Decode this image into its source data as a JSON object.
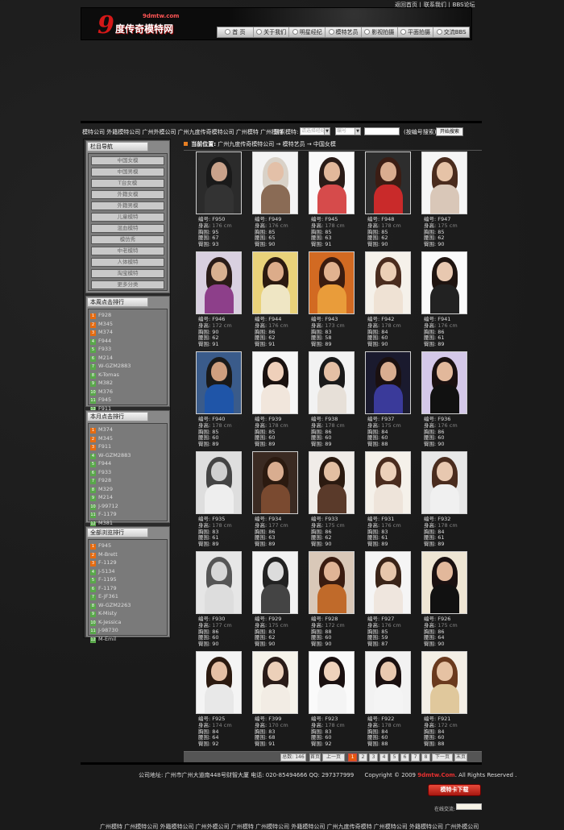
{
  "toplinks": [
    "返回首页",
    "|",
    "联系我们",
    "|",
    "BBS论坛"
  ],
  "header": {
    "logo_nine": "9",
    "logo_domain": "9dmtw.com",
    "logo_cn": "度传奇模特网",
    "nav": [
      "首 页",
      "关于我们",
      "明星经纪",
      "模特艺员",
      "影视拍摄",
      "平面拍摄",
      "交流BBS"
    ]
  },
  "search": {
    "keywords": "模特公司 外籍模特公司 广州外模公司 广州九度传奇模特公司 广州模特 广州模特",
    "label": "搜索模特:",
    "select1": "请选择经纪",
    "select2": "编号",
    "hint": "(按编号搜索)",
    "button": "开始搜索"
  },
  "sidebar": {
    "nav_title": "栏目导航",
    "nav_items": [
      "中国女模",
      "中国男模",
      "T台女模",
      "外籍女模",
      "外籍男模",
      "儿童模特",
      "混血模特",
      "模仿秀",
      "中老模特",
      "人体模特",
      "淘宝模特",
      "更多分类"
    ],
    "week_title": "本周点击排行",
    "week_items": [
      "F928",
      "M345",
      "M374",
      "F944",
      "F933",
      "M214",
      "W-GZM2883",
      "K-Tomas",
      "M382",
      "M376",
      "F945",
      "F911"
    ],
    "month_title": "本月点击排行",
    "month_items": [
      "M374",
      "M345",
      "F911",
      "W-GZM2883",
      "F944",
      "F933",
      "F928",
      "M329",
      "M214",
      "J-99712",
      "F-1179",
      "M381"
    ],
    "all_title": "全部浏览排行",
    "all_items": [
      "F945",
      "M-Brett",
      "F-1129",
      "J-5134",
      "F-1195",
      "F-1179",
      "E-JF361",
      "W-GZM2263",
      "K-Misty",
      "K-Jessica",
      "J-98730",
      "M-Emil"
    ]
  },
  "breadcrumb": {
    "label": "当前位置:",
    "path": "广州九度传奇模特公司 → 模特艺员 → 中国女模"
  },
  "field_labels": {
    "id": "编号:",
    "height": "身高:",
    "bust": "胸围:",
    "waist": "腰围:",
    "hip": "臀围:"
  },
  "models": [
    {
      "id": "F950",
      "height": "176 cm",
      "bust": "95",
      "waist": "67",
      "hip": "93"
    },
    {
      "id": "F949",
      "height": "176 cm",
      "bust": "85",
      "waist": "65",
      "hip": "90"
    },
    {
      "id": "F945",
      "height": "178 cm",
      "bust": "85",
      "waist": "63",
      "hip": "91"
    },
    {
      "id": "F948",
      "height": "178 cm",
      "bust": "85",
      "waist": "62",
      "hip": "90"
    },
    {
      "id": "F947",
      "height": "175 cm",
      "bust": "85",
      "waist": "62",
      "hip": "90"
    },
    {
      "id": "F946",
      "height": "172 cm",
      "bust": "90",
      "waist": "62",
      "hip": "91"
    },
    {
      "id": "F944",
      "height": "176 cm",
      "bust": "86",
      "waist": "62",
      "hip": "91"
    },
    {
      "id": "F943",
      "height": "173 cm",
      "bust": "83",
      "waist": "58",
      "hip": "89"
    },
    {
      "id": "F942",
      "height": "178 cm",
      "bust": "84",
      "waist": "60",
      "hip": "90"
    },
    {
      "id": "F941",
      "height": "176 cm",
      "bust": "86",
      "waist": "61",
      "hip": "89"
    },
    {
      "id": "F940",
      "height": "178 cm",
      "bust": "85",
      "waist": "60",
      "hip": "89"
    },
    {
      "id": "F939",
      "height": "178 cm",
      "bust": "85",
      "waist": "60",
      "hip": "89"
    },
    {
      "id": "F938",
      "height": "178 cm",
      "bust": "86",
      "waist": "60",
      "hip": "89"
    },
    {
      "id": "F937",
      "height": "175 cm",
      "bust": "84",
      "waist": "60",
      "hip": "88"
    },
    {
      "id": "F936",
      "height": "176 cm",
      "bust": "86",
      "waist": "60",
      "hip": "90"
    },
    {
      "id": "F935",
      "height": "178 cm",
      "bust": "83",
      "waist": "61",
      "hip": "89"
    },
    {
      "id": "F934",
      "height": "177 cm",
      "bust": "86",
      "waist": "63",
      "hip": "89"
    },
    {
      "id": "F933",
      "height": "175 cm",
      "bust": "86",
      "waist": "62",
      "hip": "90"
    },
    {
      "id": "F931",
      "height": "176 cm",
      "bust": "83",
      "waist": "61",
      "hip": "89"
    },
    {
      "id": "F932",
      "height": "178 cm",
      "bust": "84",
      "waist": "61",
      "hip": "89"
    },
    {
      "id": "F930",
      "height": "177 cm",
      "bust": "86",
      "waist": "60",
      "hip": "90"
    },
    {
      "id": "F929",
      "height": "175 cm",
      "bust": "83",
      "waist": "62",
      "hip": "90"
    },
    {
      "id": "F928",
      "height": "172 cm",
      "bust": "88",
      "waist": "60",
      "hip": "90"
    },
    {
      "id": "F927",
      "height": "176 cm",
      "bust": "85",
      "waist": "59",
      "hip": "87"
    },
    {
      "id": "F926",
      "height": "175 cm",
      "bust": "86",
      "waist": "64",
      "hip": "90"
    },
    {
      "id": "F925",
      "height": "174 cm",
      "bust": "84",
      "waist": "64",
      "hip": "92"
    },
    {
      "id": "F399",
      "height": "170 cm",
      "bust": "83",
      "waist": "68",
      "hip": "91"
    },
    {
      "id": "F923",
      "height": "178 cm",
      "bust": "83",
      "waist": "60",
      "hip": "92"
    },
    {
      "id": "F922",
      "height": "178 cm",
      "bust": "84",
      "waist": "60",
      "hip": "88"
    },
    {
      "id": "F921",
      "height": "172 cm",
      "bust": "84",
      "waist": "60",
      "hip": "88"
    }
  ],
  "pager": {
    "total": "总数: 146",
    "first": "首页",
    "prev": "上一页",
    "pages": [
      "1",
      "2",
      "3",
      "4",
      "5",
      "6",
      "7",
      "8"
    ],
    "current": "1",
    "next": "下一页",
    "last": "末页"
  },
  "footer": {
    "address": "公司地址: 广州市广州大道南448号财智大厦 电话: 020-85494666 QQ: 297377999",
    "copyright_pre": "Copyright © 2009",
    "brand_domain": "9dmtw.",
    "brand_com": "Com",
    "copyright_post": ". All Rights Reserved .",
    "download": "模特卡下载",
    "online_label": "在线交流:",
    "bottom_keywords": "广州模特 广州模特公司 外籍模特公司 广州外模公司 广州模特 广州模特公司 外籍模特公司 广州九度传奇模特 广州模特公司 外籍模特公司 广州外模公司"
  },
  "colors": {
    "accent": "#e65a10",
    "brand_red": "#d41818",
    "rank_green": "#59a84a"
  }
}
